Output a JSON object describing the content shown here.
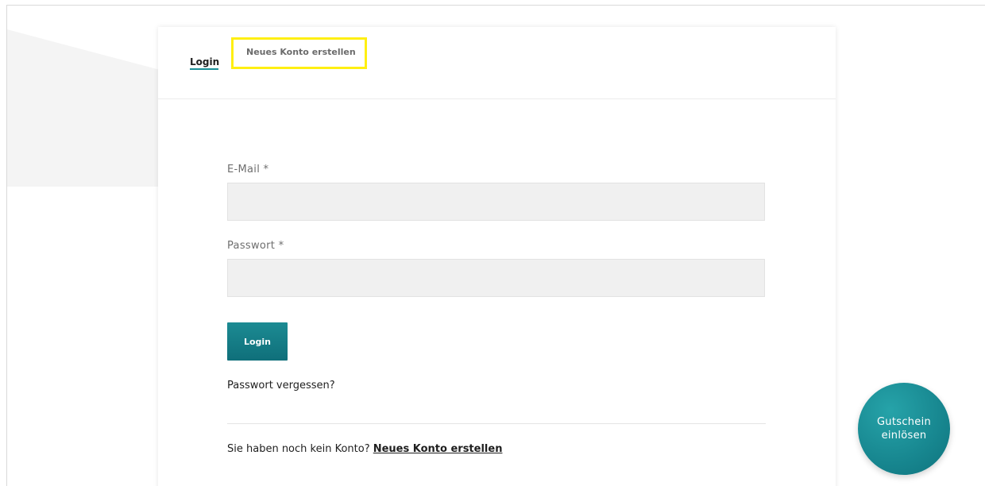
{
  "tabs": {
    "login_label": "Login",
    "register_label": "Neues Konto erstellen"
  },
  "form": {
    "email_label": "E-Mail *",
    "email_value": "",
    "password_label": "Passwort *",
    "password_value": "",
    "login_button_label": "Login",
    "forgot_password_label": "Passwort vergessen?",
    "no_account_text": "Sie haben noch kein Konto? ",
    "no_account_link": "Neues Konto erstellen"
  },
  "voucher": {
    "label": "Gutschein einlösen"
  },
  "colors": {
    "accent": "#1a8f96",
    "highlight": "#ffef12",
    "input_bg": "#f0f0f0"
  }
}
